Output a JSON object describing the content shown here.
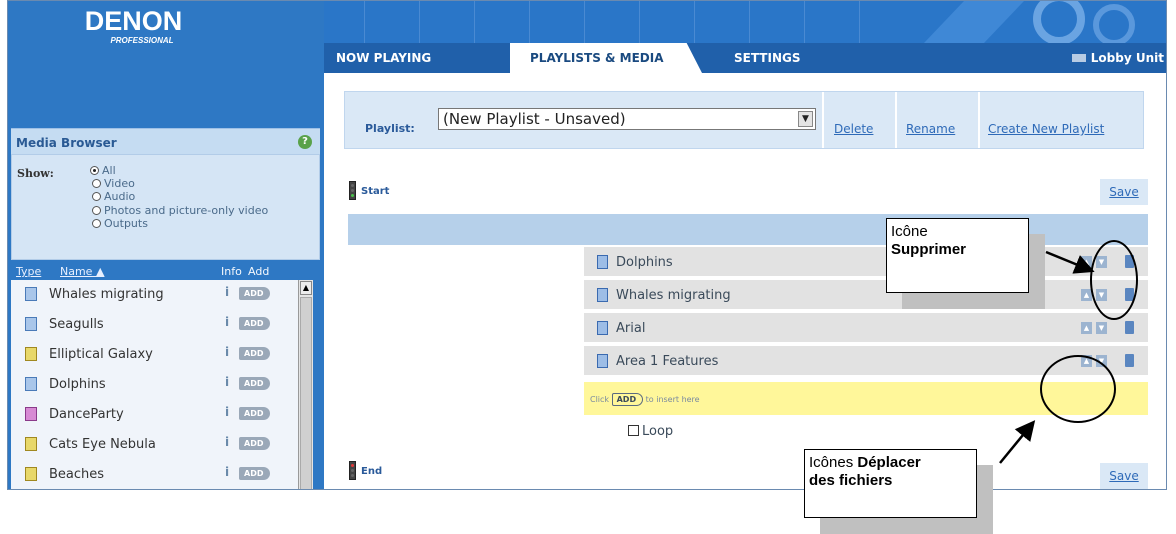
{
  "brand": {
    "name": "DENON",
    "sub": "PROFESSIONAL"
  },
  "media_browser": {
    "title": "Media Browser",
    "help": "?",
    "show_label": "Show:",
    "show_options": [
      "All",
      "Video",
      "Audio",
      "Photos and picture-only video",
      "Outputs"
    ],
    "selected_show": "All",
    "columns": {
      "type": "Type",
      "name": "Name ▲",
      "info": "Info",
      "add": "Add"
    },
    "items": [
      {
        "name": "Whales migrating",
        "kind": "video"
      },
      {
        "name": "Seagulls",
        "kind": "video"
      },
      {
        "name": "Elliptical Galaxy",
        "kind": "picture"
      },
      {
        "name": "Dolphins",
        "kind": "video"
      },
      {
        "name": "DanceParty",
        "kind": "audio"
      },
      {
        "name": "Cats Eye Nebula",
        "kind": "picture"
      },
      {
        "name": "Beaches",
        "kind": "picture"
      }
    ],
    "info_icon": "i",
    "add_label": "ADD"
  },
  "tabs": [
    {
      "label": "NOW PLAYING",
      "active": false
    },
    {
      "label": "PLAYLISTS & MEDIA",
      "active": true
    },
    {
      "label": "SETTINGS",
      "active": false
    }
  ],
  "unit": {
    "label": "Lobby Unit"
  },
  "playlist": {
    "label": "Playlist:",
    "selected": "(New Playlist - Unsaved)",
    "actions": {
      "delete": "Delete",
      "rename": "Rename",
      "create": "Create New Playlist"
    },
    "start_label": "Start",
    "end_label": "End",
    "save_label": "Save",
    "rows": [
      "Dolphins",
      "Whales migrating",
      "Arial",
      "Area 1 Features"
    ],
    "insert_prefix": "Click",
    "insert_add": "ADD",
    "insert_suffix": "to insert here",
    "loop_label": "Loop"
  },
  "annotations": {
    "delete_line1": "Icône",
    "delete_line2": "Supprimer",
    "move_prefix": "Icônes ",
    "move_bold1": "Déplacer",
    "move_bold2": "des fichiers"
  },
  "colors": {
    "panel_blue": "#2e78c4",
    "tab_bar": "#2060aa",
    "insert_highlight": "#fff79a",
    "link": "#2e6ab8"
  }
}
